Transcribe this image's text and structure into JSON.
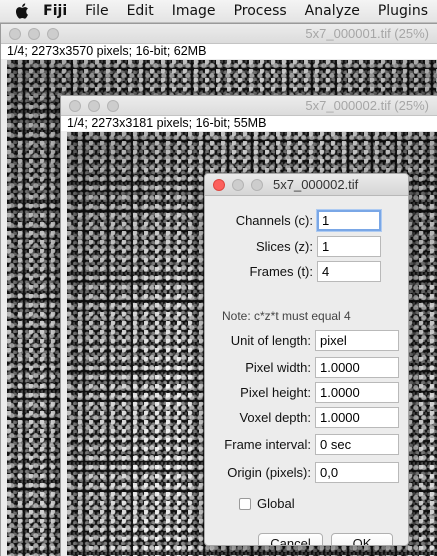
{
  "menubar": {
    "apple_icon": "apple-logo-icon",
    "items": [
      "Fiji",
      "File",
      "Edit",
      "Image",
      "Process",
      "Analyze",
      "Plugins"
    ]
  },
  "window1": {
    "title": "5x7_000001.tif (25%)",
    "info": "1/4; 2273x3570 pixels; 16-bit; 62MB"
  },
  "window2": {
    "title": "5x7_000002.tif (25%)",
    "info": "1/4; 2273x3181 pixels; 16-bit; 55MB"
  },
  "dialog": {
    "title": "5x7_000002.tif",
    "channels_label": "Channels (c):",
    "channels_value": "1",
    "slices_label": "Slices (z):",
    "slices_value": "1",
    "frames_label": "Frames (t):",
    "frames_value": "4",
    "note": "Note: c*z*t must equal 4",
    "unit_label": "Unit of length:",
    "unit_value": "pixel",
    "pixel_width_label": "Pixel width:",
    "pixel_width_value": "1.0000",
    "pixel_height_label": "Pixel height:",
    "pixel_height_value": "1.0000",
    "voxel_depth_label": "Voxel depth:",
    "voxel_depth_value": "1.0000",
    "frame_interval_label": "Frame interval:",
    "frame_interval_value": "0 sec",
    "origin_label": "Origin (pixels):",
    "origin_value": "0,0",
    "global_label": "Global",
    "global_checked": false,
    "cancel_label": "Cancel",
    "ok_label": "OK"
  },
  "colors": {
    "close_red": "#fc605c",
    "focus_blue": "#7aa7e6"
  }
}
